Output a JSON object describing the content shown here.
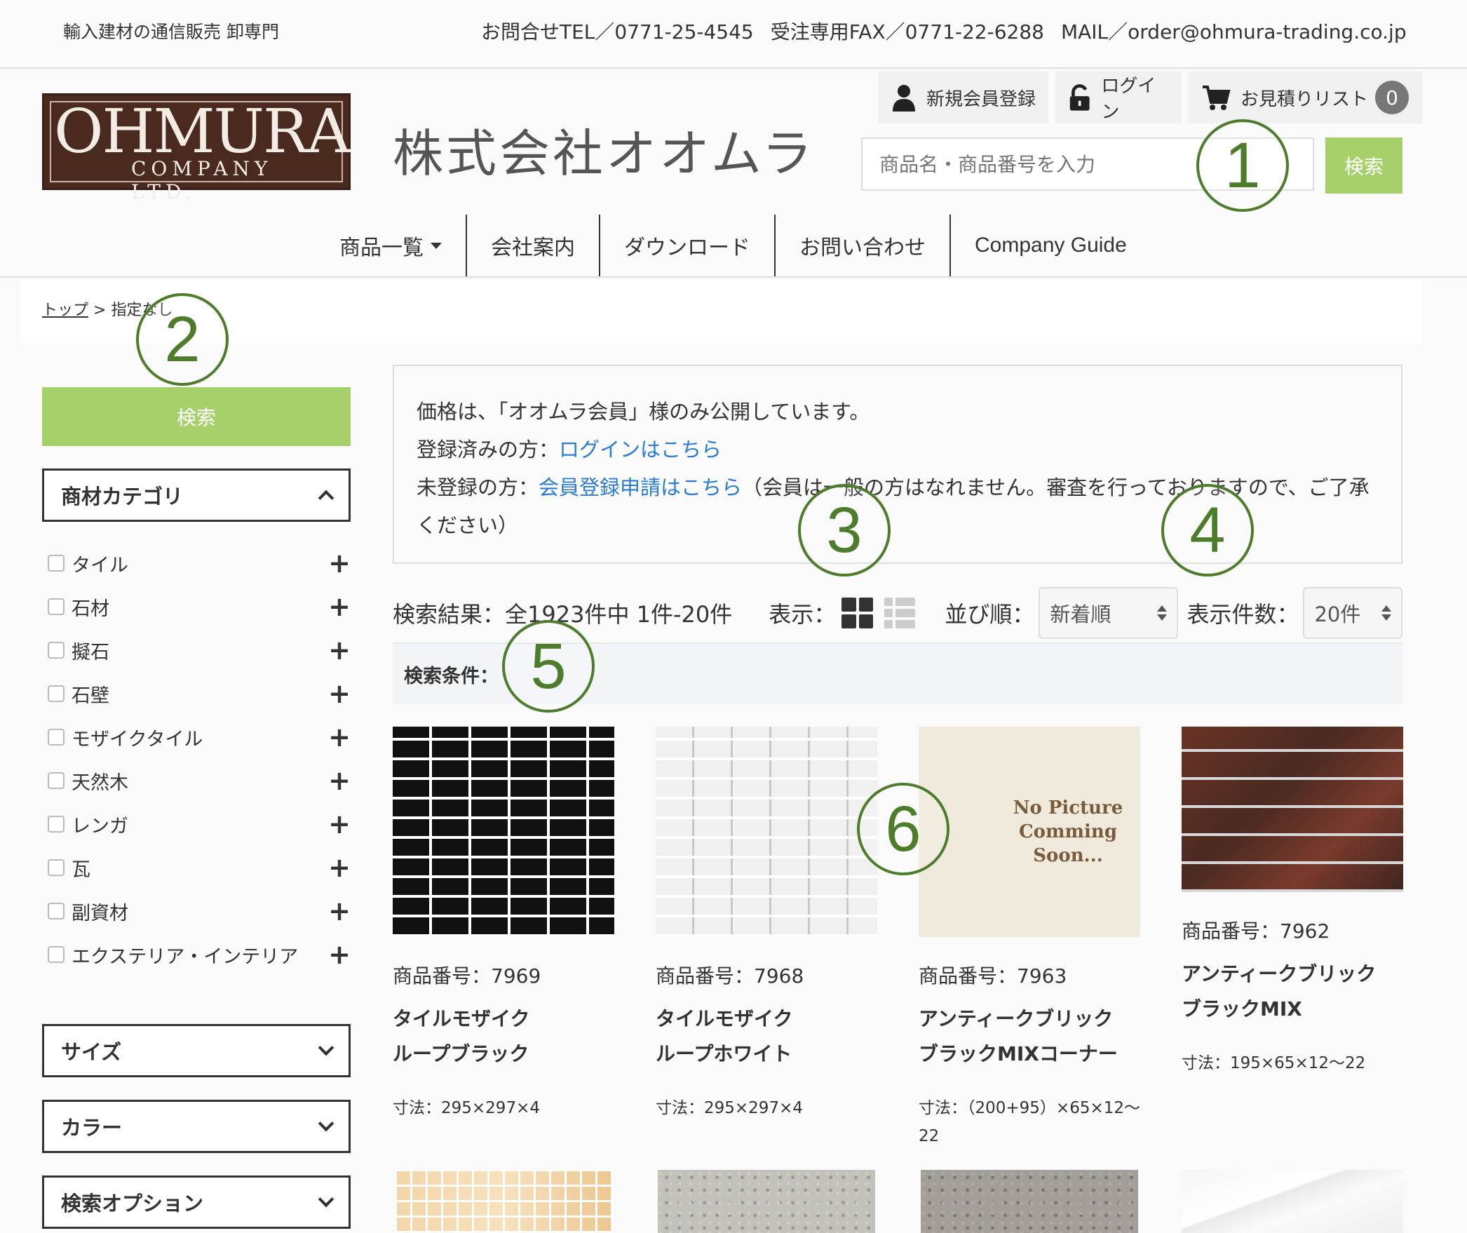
{
  "topbar": {
    "tagline": "輸入建材の通信販売 卸専門",
    "tel": "お問合せTEL／0771-25-4545",
    "fax": "受注専用FAX／0771-22-6288",
    "mail": "MAIL／order@ohmura-trading.co.jp"
  },
  "header": {
    "logo_big": "OHMURA",
    "logo_small": "COMPANY LTD.",
    "company_name": "株式会社オオムラ",
    "register_label": "新規会員登録",
    "login_label": "ログイン",
    "quote_label": "お見積りリスト",
    "quote_count": "0",
    "search_placeholder": "商品名・商品番号を入力",
    "search_button": "検索"
  },
  "nav": {
    "items": [
      "商品一覧",
      "会社案内",
      "ダウンロード",
      "お問い合わせ",
      "Company Guide"
    ]
  },
  "breadcrumb": {
    "home": "トップ",
    "sep": ">",
    "current": "指定なし"
  },
  "sidebar": {
    "search_button": "検索",
    "category_title": "商材カテゴリ",
    "categories": [
      "タイル",
      "石材",
      "擬石",
      "石壁",
      "モザイクタイル",
      "天然木",
      "レンガ",
      "瓦",
      "副資材",
      "エクステリア・インテリア"
    ],
    "size_title": "サイズ",
    "color_title": "カラー",
    "option_title": "検索オプション"
  },
  "notice": {
    "line1": "価格は、「オオムラ会員」様のみ公開しています。",
    "registered_prefix": "登録済みの方：",
    "login_link": "ログインはこちら",
    "unregistered_prefix": "未登録の方：",
    "apply_link": "会員登録申請はこちら",
    "apply_note": "（会員は一般の方はなれません。審査を行っておりますので、ご了承ください）"
  },
  "results": {
    "summary": "検索結果：全1923件中 1件-20件",
    "view_label": "表示：",
    "sort_label": "並び順：",
    "sort_value": "新着順",
    "count_label": "表示件数：",
    "count_value": "20件",
    "conditions_label": "検索条件："
  },
  "products": [
    {
      "number": "商品番号：7969",
      "name1": "タイルモザイク",
      "name2": "ループブラック",
      "dimension": "寸法：295×297×4"
    },
    {
      "number": "商品番号：7968",
      "name1": "タイルモザイク",
      "name2": "ループホワイト",
      "dimension": "寸法：295×297×4"
    },
    {
      "number": "商品番号：7963",
      "name1": "アンティークブリック",
      "name2": "ブラックMIXコーナー",
      "dimension": "寸法：（200+95）×65×12〜22",
      "image_text1": "No Picture",
      "image_text2": "Comming Soon..."
    },
    {
      "number": "商品番号：7962",
      "name1": "アンティークブリック",
      "name2": "ブラックMIX",
      "dimension": "寸法：195×65×12〜22"
    }
  ],
  "annotations": [
    "1",
    "2",
    "3",
    "4",
    "5",
    "6"
  ],
  "colors": {
    "accent_green": "#a6d16a",
    "annotation_green": "#4d7c2a",
    "link_blue": "#2a7bd6",
    "logo_brown": "#4a2a1e"
  }
}
